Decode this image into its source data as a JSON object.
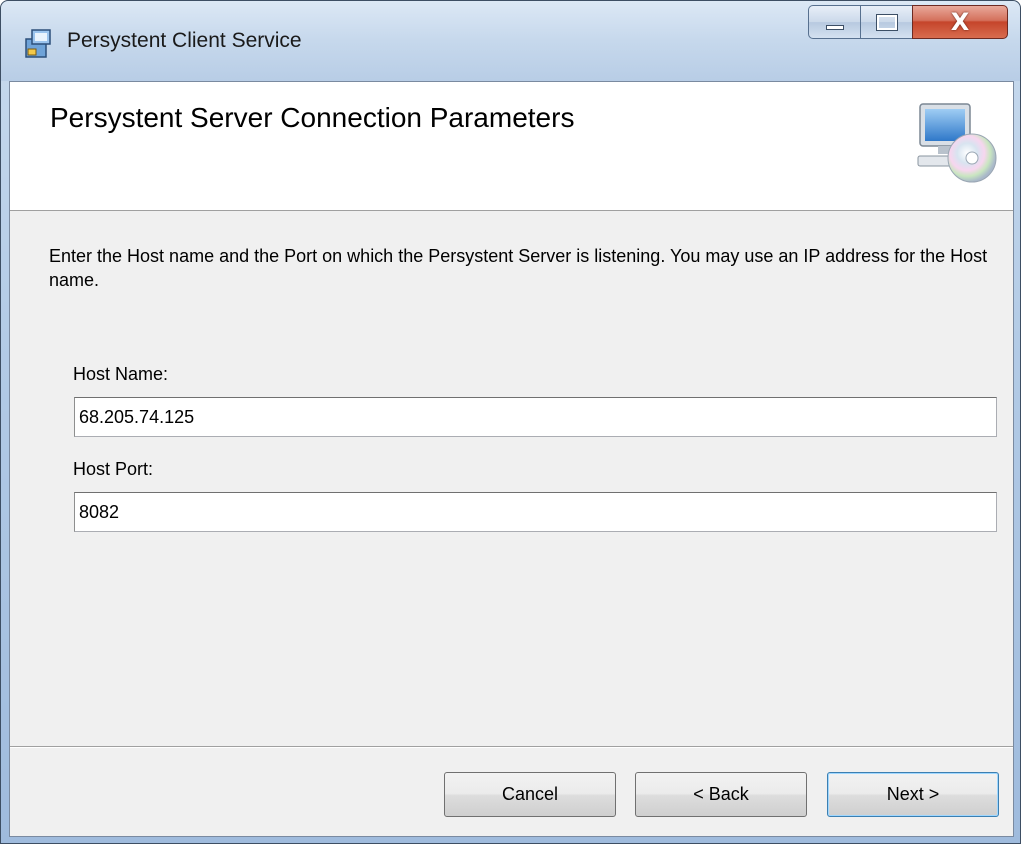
{
  "window": {
    "title": "Persystent Client Service",
    "caption_buttons": {
      "minimize_icon": "minimize-icon",
      "maximize_icon": "maximize-icon",
      "close_glyph": "X"
    }
  },
  "banner": {
    "title": "Persystent Server Connection Parameters",
    "icon": "computer-disc-icon"
  },
  "body": {
    "description": "Enter the Host name and the Port on which the Persystent Server is listening. You may use an IP address for the Host name."
  },
  "form": {
    "host_name_label": "Host Name:",
    "host_name_value": "68.205.74.125",
    "host_port_label": "Host Port:",
    "host_port_value": "8082"
  },
  "buttons": {
    "cancel": "Cancel",
    "back": "< Back",
    "next": "Next >"
  },
  "colors": {
    "client_bg": "#f0f0f0",
    "banner_bg": "#ffffff",
    "close_red": "#c5452b"
  }
}
